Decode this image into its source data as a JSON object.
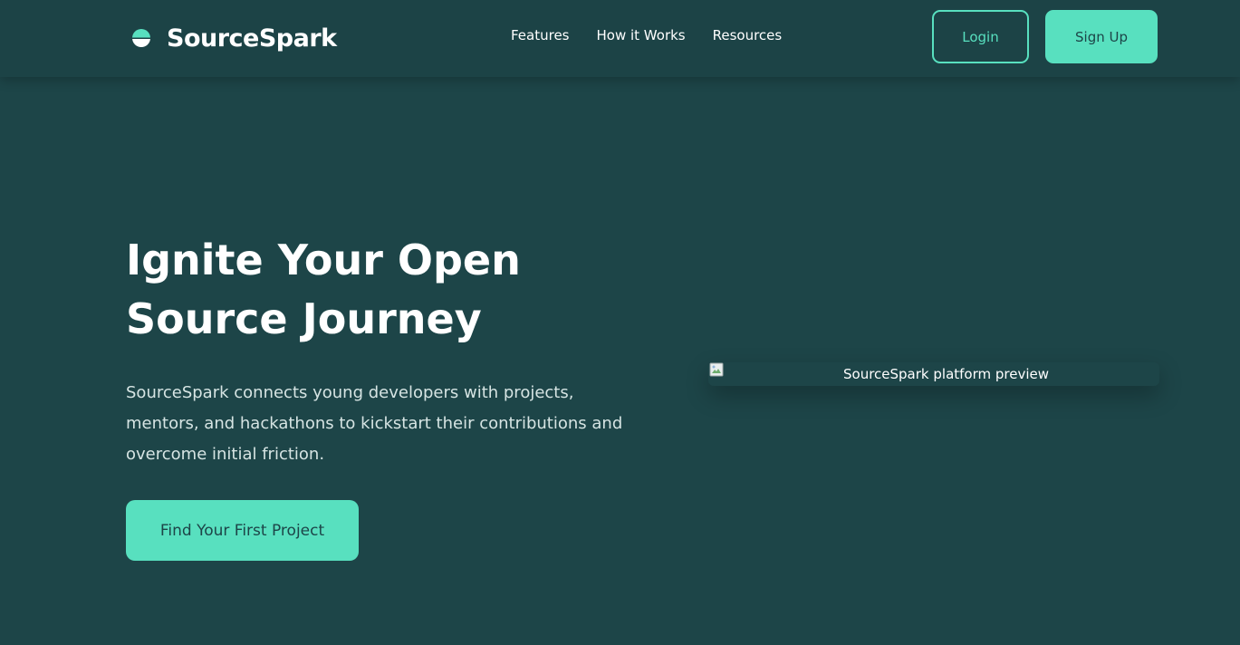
{
  "brand": {
    "name": "SourceSpark",
    "accent": "#58e0bf",
    "background": "#1d4548"
  },
  "nav": {
    "links": [
      {
        "label": "Features"
      },
      {
        "label": "How it Works"
      },
      {
        "label": "Resources"
      }
    ],
    "login_label": "Login",
    "signup_label": "Sign Up"
  },
  "hero": {
    "title": "Ignite Your Open Source Journey",
    "description": "SourceSpark connects young developers with projects, mentors, and hackathons to kickstart their contributions and overcome initial friction.",
    "cta_label": "Find Your First Project",
    "preview_alt": "SourceSpark platform preview",
    "preview_icon": "broken-image-icon"
  }
}
